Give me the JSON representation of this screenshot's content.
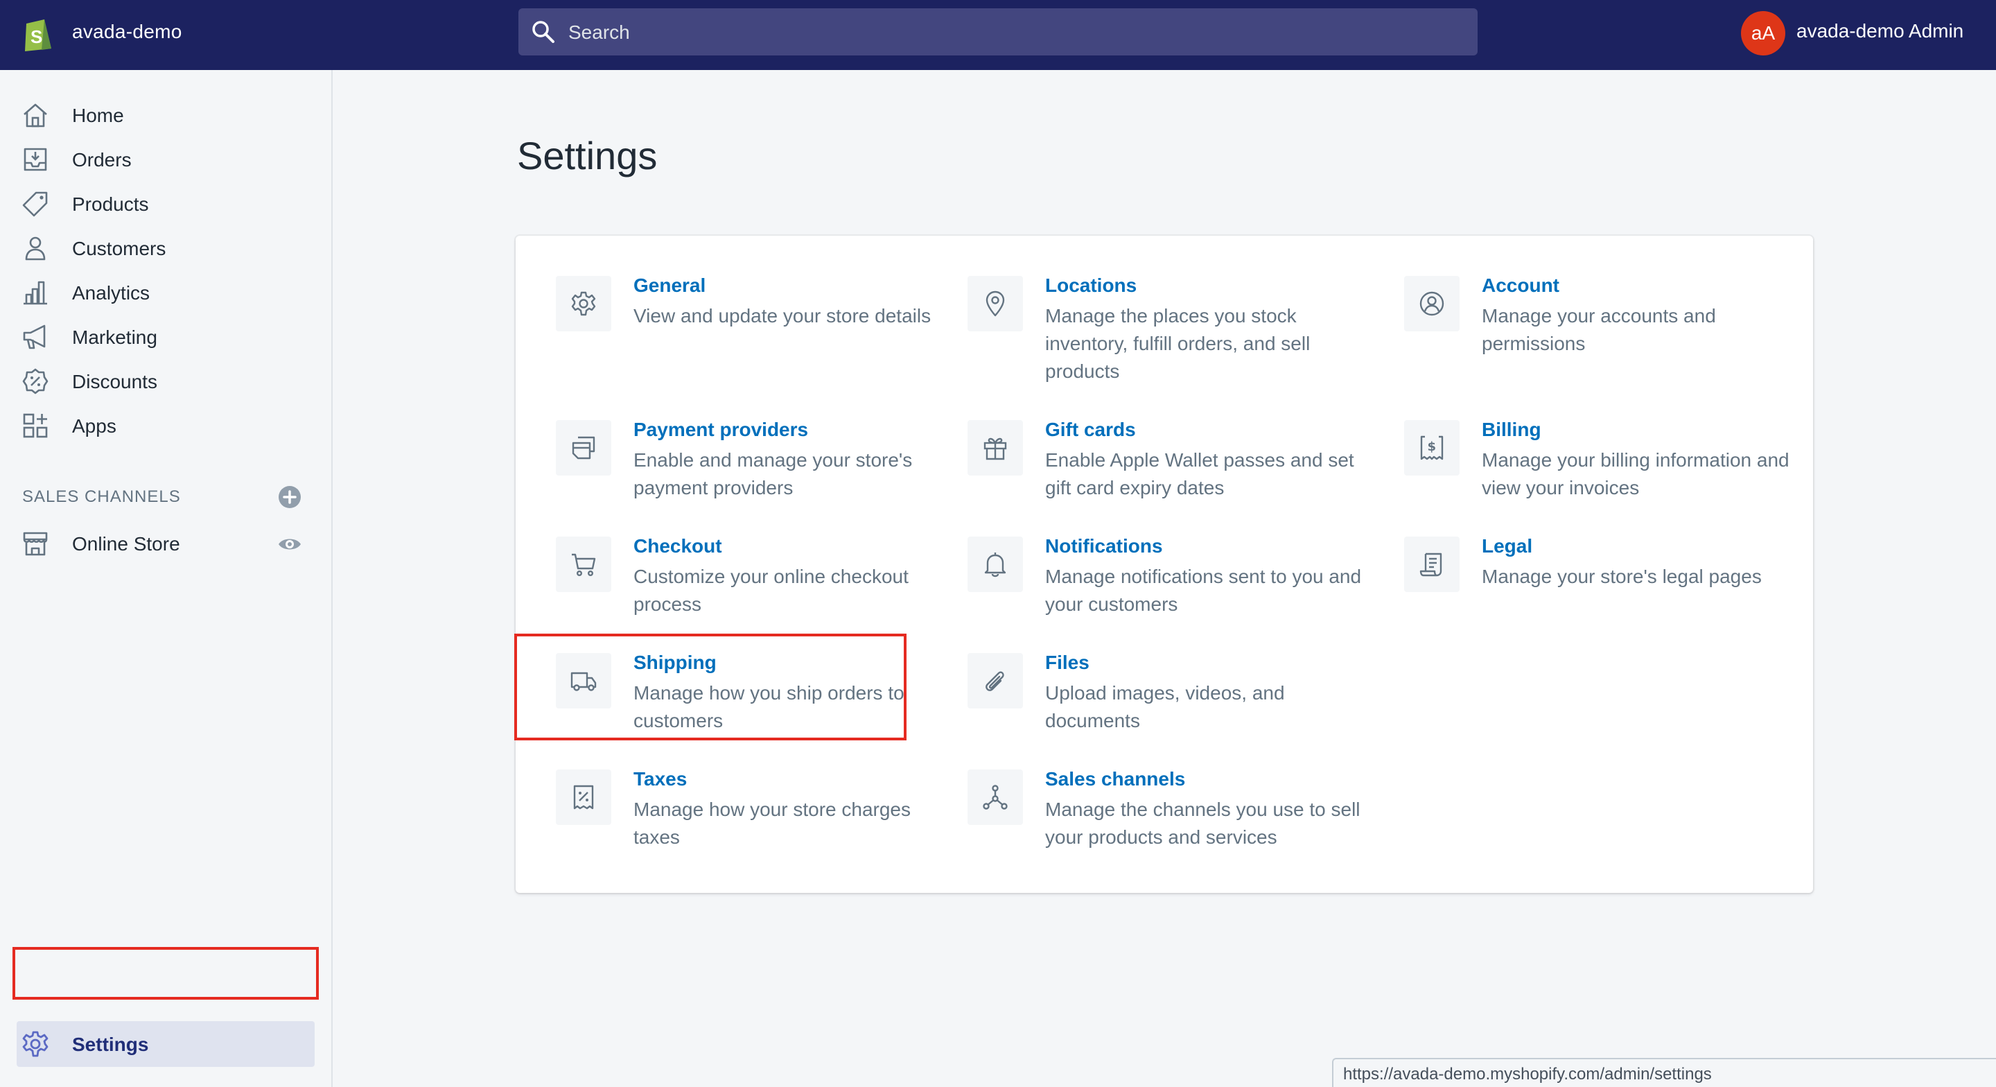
{
  "topbar": {
    "store_name": "avada-demo",
    "search_placeholder": "Search",
    "avatar_initials": "aA",
    "admin_name": "avada-demo Admin"
  },
  "sidebar": {
    "items": [
      {
        "label": "Home",
        "icon": "home-icon"
      },
      {
        "label": "Orders",
        "icon": "orders-icon"
      },
      {
        "label": "Products",
        "icon": "tag-icon"
      },
      {
        "label": "Customers",
        "icon": "person-icon"
      },
      {
        "label": "Analytics",
        "icon": "bar-chart-icon"
      },
      {
        "label": "Marketing",
        "icon": "megaphone-icon"
      },
      {
        "label": "Discounts",
        "icon": "discount-icon"
      },
      {
        "label": "Apps",
        "icon": "apps-icon"
      }
    ],
    "sales_channels_heading": "SALES CHANNELS",
    "online_store": "Online Store",
    "settings": "Settings"
  },
  "main": {
    "title": "Settings",
    "tiles": [
      {
        "title": "General",
        "desc": "View and update your store details",
        "icon": "gear-icon"
      },
      {
        "title": "Locations",
        "desc": "Manage the places you stock inventory, fulfill orders, and sell products",
        "icon": "location-pin-icon"
      },
      {
        "title": "Account",
        "desc": "Manage your accounts and permissions",
        "icon": "account-icon"
      },
      {
        "title": "Payment providers",
        "desc": "Enable and manage your store's payment providers",
        "icon": "payment-icon"
      },
      {
        "title": "Gift cards",
        "desc": "Enable Apple Wallet passes and set gift card expiry dates",
        "icon": "gift-icon"
      },
      {
        "title": "Billing",
        "desc": "Manage your billing information and view your invoices",
        "icon": "billing-icon"
      },
      {
        "title": "Checkout",
        "desc": "Customize your online checkout process",
        "icon": "cart-icon"
      },
      {
        "title": "Notifications",
        "desc": "Manage notifications sent to you and your customers",
        "icon": "bell-icon"
      },
      {
        "title": "Legal",
        "desc": "Manage your store's legal pages",
        "icon": "legal-icon"
      },
      {
        "title": "Shipping",
        "desc": "Manage how you ship orders to customers",
        "icon": "truck-icon"
      },
      {
        "title": "Files",
        "desc": "Upload images, videos, and documents",
        "icon": "paperclip-icon"
      },
      {
        "title": "Taxes",
        "desc": "Manage how your store charges taxes",
        "icon": "tax-icon"
      },
      {
        "title": "Sales channels",
        "desc": "Manage the channels you use to sell your products and services",
        "icon": "channels-icon"
      }
    ]
  },
  "statusbar": {
    "url": "https://avada-demo.myshopify.com/admin/settings"
  }
}
